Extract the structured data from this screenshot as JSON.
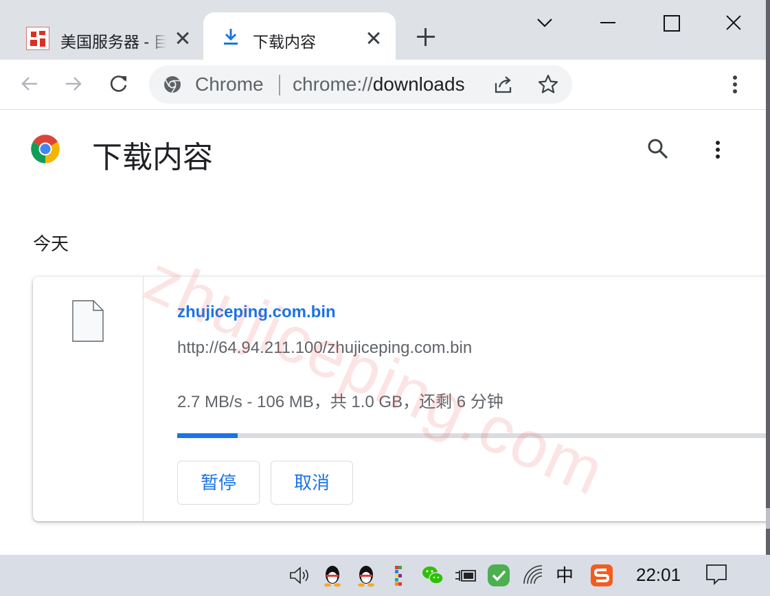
{
  "window": {
    "tabs": [
      {
        "title": "美国服务器 - 目",
        "active": false,
        "favicon": "site-seal-icon"
      },
      {
        "title": "下载内容",
        "active": true,
        "favicon": "download-icon"
      }
    ]
  },
  "toolbar": {
    "omnibox_chip": "Chrome",
    "url_scheme": "chrome://",
    "url_rest": "downloads"
  },
  "page": {
    "title": "下载内容",
    "section_date": "今天",
    "download": {
      "file_name": "zhujiceping.com.bin",
      "source_url": "http://64.94.211.100/zhujiceping.com.bin",
      "status": "2.7 MB/s - 106 MB，共 1.0 GB，还剩 6 分钟",
      "progress_fraction": 0.1,
      "pause_label": "暂停",
      "cancel_label": "取消"
    },
    "watermark": "zhujiceping.com"
  },
  "taskbar": {
    "clock": "22:01",
    "ime": "中",
    "tray_icons": [
      "volume-icon",
      "qq-icon",
      "qq-icon",
      "color-app-icon",
      "wechat-icon",
      "power-plug-icon",
      "security-check-icon",
      "wifi-icon",
      "ime-icon",
      "sogou-icon",
      "notification-icon"
    ]
  },
  "colors": {
    "accent": "#1a73e8",
    "tabstrip": "#dee1e6",
    "taskbar": "#d8dde6"
  }
}
